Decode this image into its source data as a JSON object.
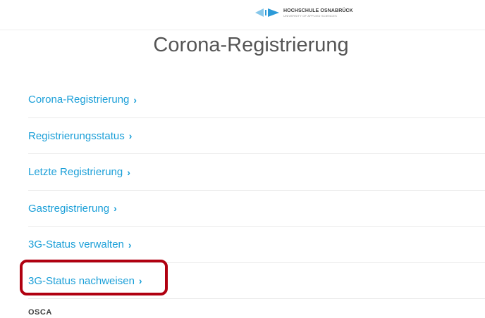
{
  "header": {
    "university_name": "HOCHSCHULE OSNABRÜCK",
    "university_sub": "UNIVERSITY OF APPLIED SCIENCES"
  },
  "title": "Corona-Registrierung",
  "nav": {
    "items": [
      {
        "label": "Corona-Registrierung"
      },
      {
        "label": "Registrierungsstatus"
      },
      {
        "label": "Letzte Registrierung"
      },
      {
        "label": "Gastregistrierung"
      },
      {
        "label": "3G-Status verwalten"
      },
      {
        "label": "3G-Status nachweisen",
        "highlighted": true
      }
    ],
    "chevron": "›"
  },
  "footer": {
    "brand": "OSCA"
  },
  "colors": {
    "link": "#1b9fd8",
    "title": "#555555",
    "highlight": "#b00010",
    "logo_primary": "#2c9ad8",
    "logo_secondary": "#86c7ea"
  },
  "icons": [
    "university-logo-icon",
    "chevron-right-icon",
    "osca-logo-icon"
  ]
}
